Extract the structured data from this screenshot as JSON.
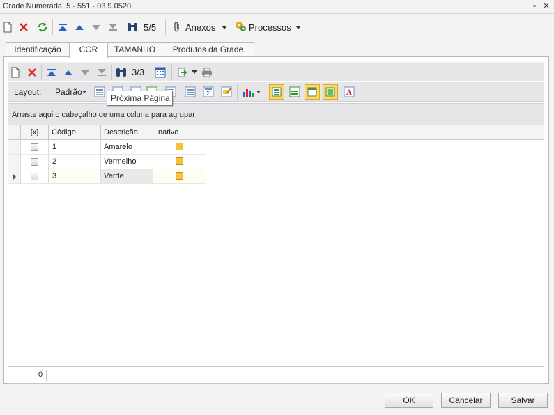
{
  "window": {
    "title": "Grade Numerada: 5 - 551 - 03.9.0520",
    "restore_glyph": "▫",
    "close_glyph": "✕"
  },
  "main_toolbar": {
    "record_counter": "5/5",
    "attachments_label": "Anexos",
    "processes_label": "Processos"
  },
  "tabs": [
    {
      "label": "Identificação",
      "active": false
    },
    {
      "label": "COR",
      "active": true
    },
    {
      "label": "TAMANHO",
      "active": false
    },
    {
      "label": "Produtos da Grade",
      "active": false
    }
  ],
  "inner_toolbar": {
    "record_counter": "3/3"
  },
  "layout_toolbar": {
    "layout_label": "Layout:",
    "layout_value": "Padrão"
  },
  "tooltip": "Próxima Página",
  "group_panel": {
    "hint": "Arraste aqui o cabeçalho de uma coluna para agrupar"
  },
  "grid": {
    "columns": [
      "[x]",
      "Código",
      "Descrição",
      "Inativo"
    ],
    "rows": [
      {
        "codigo": "1",
        "descricao": "Amarelo",
        "current": false
      },
      {
        "codigo": "2",
        "descricao": "Vermelho",
        "current": false
      },
      {
        "codigo": "3",
        "descricao": "Verde",
        "current": true
      }
    ],
    "footer_count": "0"
  },
  "buttons": {
    "ok": "OK",
    "cancel": "Cancelar",
    "save": "Salvar"
  },
  "colors": {
    "accent_yellow": "#f8c13a",
    "delete_red": "#d9261c",
    "nav_blue": "#2a62c4",
    "refresh_green": "#2a9a2a"
  }
}
